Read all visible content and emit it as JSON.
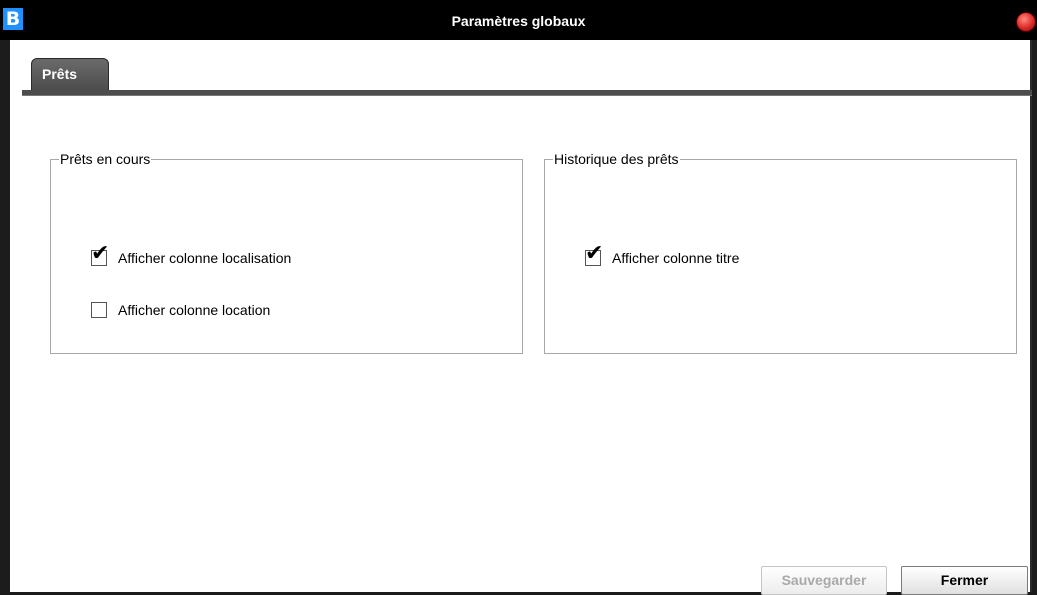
{
  "window": {
    "title": "Paramètres globaux",
    "logo_letter": "B"
  },
  "tabs": [
    {
      "label": "Prêts",
      "selected": true
    }
  ],
  "groups": {
    "current_loans": {
      "legend": "Prêts en cours",
      "options": [
        {
          "label": "Afficher colonne localisation",
          "checked": true
        },
        {
          "label": "Afficher colonne location",
          "checked": false
        }
      ]
    },
    "loan_history": {
      "legend": "Historique des prêts",
      "options": [
        {
          "label": "Afficher colonne titre",
          "checked": true
        }
      ]
    }
  },
  "buttons": {
    "save_label": "Sauvegarder",
    "save_enabled": false,
    "close_label": "Fermer"
  },
  "icons": {
    "checkmark_glyph": "✔"
  },
  "colors": {
    "titlebar": "#000000",
    "logo": "#1e90ff",
    "close_button": "#e53935",
    "tab": "#5a5a5a",
    "disabled_text": "#a9a9a9"
  }
}
